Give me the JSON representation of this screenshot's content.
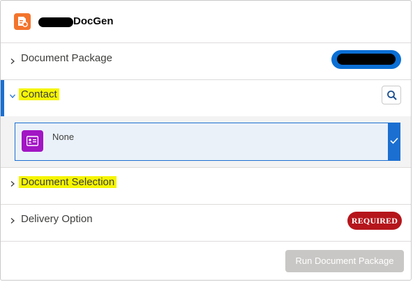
{
  "header": {
    "app_title": "DocGen",
    "icon": "document-gear-icon",
    "brand_color": "#f3742c"
  },
  "rows": {
    "document_package": {
      "label": "Document Package",
      "icon": "chevron-right-icon"
    },
    "contact": {
      "label": "Contact",
      "icon": "chevron-down-icon",
      "action_icon": "search-icon"
    },
    "document_selection": {
      "label": "Document Selection",
      "icon": "chevron-right-icon"
    },
    "delivery_option": {
      "label": "Delivery Option",
      "icon": "chevron-right-icon",
      "badge": "REQUIRED",
      "badge_color": "#b5161c"
    }
  },
  "contact_option": {
    "label": "None",
    "icon": "contact-card-icon",
    "selected": true,
    "icon_color": "#a216c4",
    "accent_color": "#1b6fd1"
  },
  "footer": {
    "run_button": "Run Document Package",
    "run_disabled": true
  }
}
